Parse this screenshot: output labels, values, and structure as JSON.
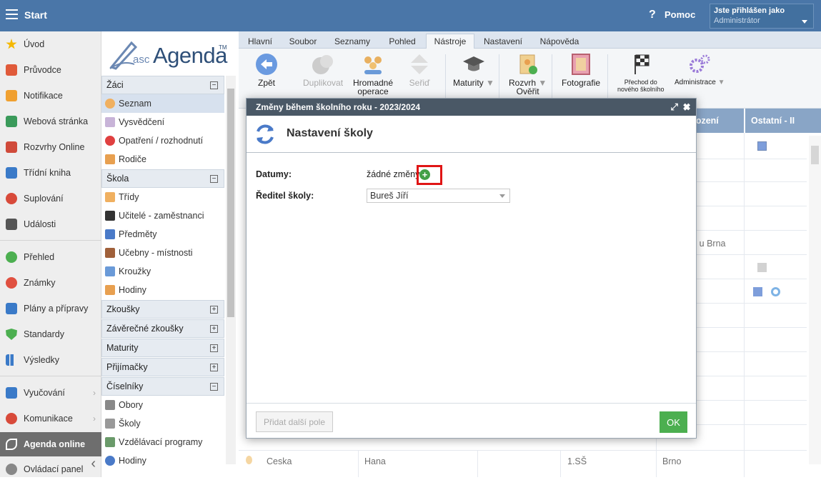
{
  "topbar": {
    "start": "Start",
    "help_icon": "?",
    "help": "Pomoc",
    "user_line1": "Jste přihlášen jako",
    "user_line2": "Administrátor"
  },
  "leftnav": {
    "items": [
      "Úvod",
      "Průvodce",
      "Notifikace",
      "Webová stránka",
      "Rozvrhy Online",
      "Třídní kniha",
      "Suplování",
      "Události",
      "Přehled",
      "Známky",
      "Plány a přípravy",
      "Standardy",
      "Výsledky",
      "Vyučování",
      "Komunikace",
      "Agenda online",
      "Ovládací panel"
    ],
    "active": "Agenda online"
  },
  "logo": {
    "asc": "asc",
    "agenda": "Agenda",
    "tm": "TM"
  },
  "sections": {
    "zaci": {
      "title": "Žáci",
      "items": [
        "Seznam",
        "Vysvědčení",
        "Opatření / rozhodnutí",
        "Rodiče"
      ]
    },
    "skola": {
      "title": "Škola",
      "items": [
        "Třídy",
        "Učitelé - zaměstnanci",
        "Předměty",
        "Učebny - místnosti",
        "Kroužky",
        "Hodiny"
      ]
    },
    "collapsed": [
      "Zkoušky",
      "Závěrečné zkoušky",
      "Maturity",
      "Přijímačky"
    ],
    "ciselniky": {
      "title": "Číselníky",
      "items": [
        "Obory",
        "Školy",
        "Vzdělávací programy",
        "Hodiny"
      ]
    },
    "toggle_minus": "−",
    "toggle_plus": "+"
  },
  "tabs": [
    "Hlavní",
    "Soubor",
    "Seznamy",
    "Pohled",
    "Nástroje",
    "Nastavení",
    "Nápověda"
  ],
  "ribbon": {
    "zpet": "Zpět",
    "duplikovat": "Duplikovat",
    "hromadne1": "Hromadné",
    "hromadne2": "operace",
    "seradit": "Seřiď",
    "maturity": "Maturity",
    "rozvrh1": "Rozvrh",
    "rozvrh2": "Ověřit",
    "fotografie": "Fotografie",
    "prechod1": "Přechod do",
    "prechod2": "nového školního",
    "administrace": "Administrace"
  },
  "grid": {
    "headers": {
      "narozeni": "arození",
      "ostatni": "Ostatní - II"
    },
    "visible": {
      "cell_brna": "ce u Brna",
      "row1_c1": "Ceska",
      "row1_c2": "Hana",
      "row1_c3": "1.SŠ",
      "row1_c4": "Brno"
    }
  },
  "dialog": {
    "title": "Změny během školního roku - 2023/2024",
    "header": "Nastavení školy",
    "datumy_label": "Datumy:",
    "datumy_value": "žádné změny",
    "reditel_label": "Ředitel školy:",
    "reditel_value": "Bureš Jíří",
    "add_field": "Přidat další pole",
    "ok": "OK",
    "add_symbol": "+"
  },
  "colors": {
    "topbar": "#4a76a8",
    "grid_header": "#4a76a8",
    "ok": "#4caf50",
    "highlight": "#e01515",
    "add": "#43a047"
  }
}
